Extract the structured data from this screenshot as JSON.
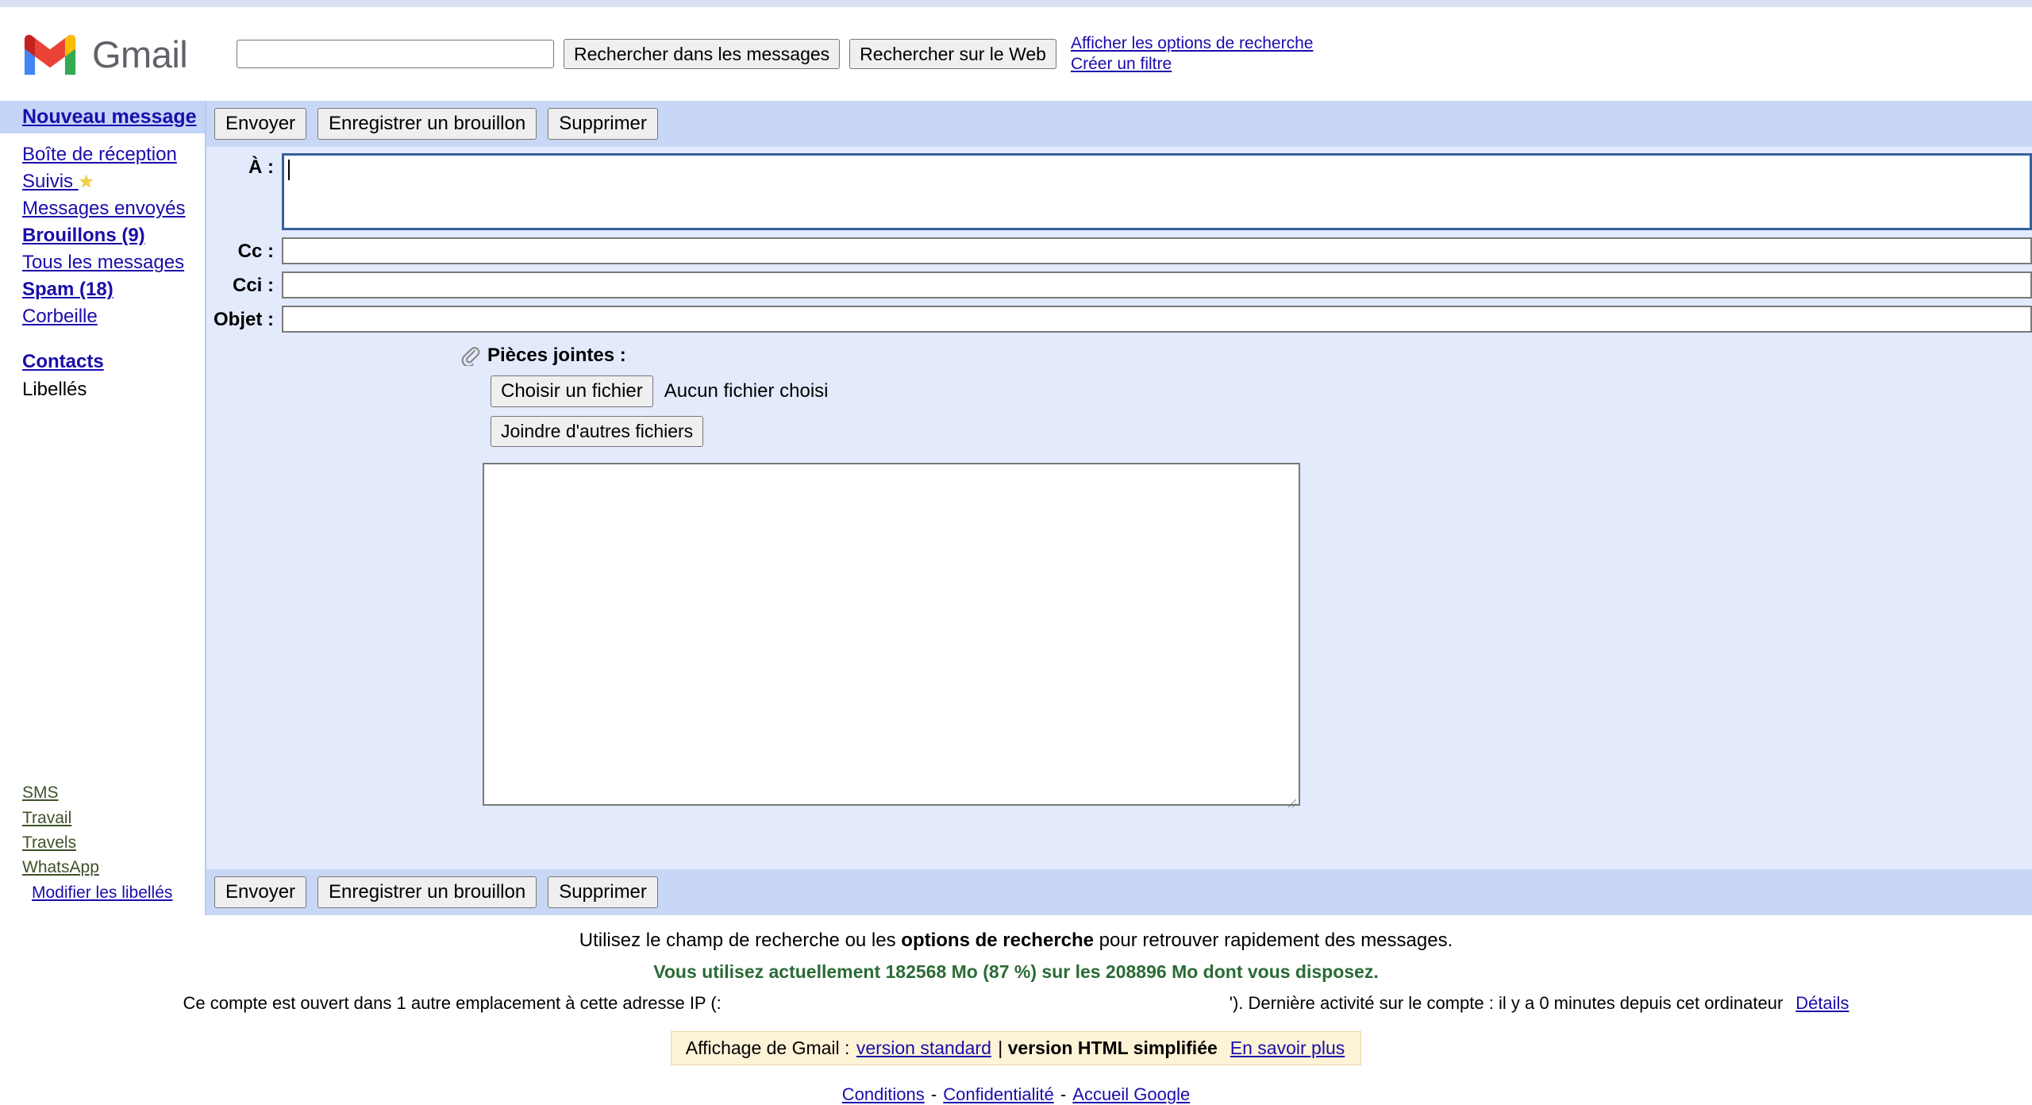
{
  "header": {
    "logo_text": "Gmail",
    "logo_icon": "gmail-m-icon",
    "search_value": "",
    "search_placeholder": "",
    "search_messages_button": "Rechercher dans les messages",
    "search_web_button": "Rechercher sur le Web",
    "show_search_options_link": "Afficher les options de recherche",
    "create_filter_link": "Créer un filtre"
  },
  "sidebar": {
    "compose_label": "Nouveau message",
    "items": [
      {
        "label": "Boîte de réception",
        "bold": false,
        "star": false
      },
      {
        "label": "Suivis ",
        "bold": false,
        "star": true
      },
      {
        "label": "Messages envoyés",
        "bold": false,
        "star": false
      },
      {
        "label": "Brouillons (9)",
        "bold": true,
        "star": false
      },
      {
        "label": "Tous les messages",
        "bold": false,
        "star": false
      },
      {
        "label": "Spam (18)",
        "bold": true,
        "star": false
      },
      {
        "label": "Corbeille",
        "bold": false,
        "star": false
      }
    ],
    "contacts_label": "Contacts",
    "labels_heading": "Libellés",
    "labels": [
      "SMS",
      "Travail",
      "Travels",
      "WhatsApp"
    ],
    "edit_labels_link": "Modifier les libellés"
  },
  "compose": {
    "toolbar": {
      "send_label": "Envoyer",
      "save_draft_label": "Enregistrer un brouillon",
      "discard_label": "Supprimer"
    },
    "fields": {
      "to_label": "À :",
      "to_value": "",
      "cc_label": "Cc :",
      "cc_value": "",
      "bcc_label": "Cci :",
      "bcc_value": "",
      "subject_label": "Objet :",
      "subject_value": ""
    },
    "attachments": {
      "icon": "paperclip-icon",
      "title": "Pièces jointes :",
      "choose_file_label": "Choisir un fichier",
      "no_file_text": "Aucun fichier choisi",
      "attach_more_label": "Joindre d'autres fichiers"
    },
    "body_value": ""
  },
  "footer": {
    "tip_prefix": "Utilisez le champ de recherche ou les ",
    "tip_bold": "options de recherche",
    "tip_suffix": " pour retrouver rapidement des messages.",
    "storage_text": "Vous utilisez actuellement 182568 Mo (87 %) sur les 208896 Mo dont vous disposez.",
    "storage_used_mb": "182568",
    "storage_percent": "87 %",
    "storage_total_mb": "208896",
    "activity_prefix": "Ce compte est ouvert dans 1 autre emplacement à cette adresse IP (:",
    "activity_suffix": "').   Dernière activité sur le compte : il y a 0 minutes depuis cet ordinateur",
    "details_link": "Détails",
    "display_prefix": "Affichage de Gmail : ",
    "display_standard_link": "version standard",
    "display_separator": " | ",
    "display_current": "version HTML simplifiée",
    "display_learn_more": "En savoir plus",
    "bottom_links": [
      "Conditions",
      "Confidentialité",
      "Accueil Google"
    ],
    "bottom_separator": " - "
  },
  "colors": {
    "link": "#1a0dab",
    "compose_bg": "#e2eafc",
    "toolbar_bg": "#c9d7f7",
    "storage_green": "#2a6b35",
    "banner_bg": "#fdf3d7",
    "label_green": "#3d5229"
  }
}
